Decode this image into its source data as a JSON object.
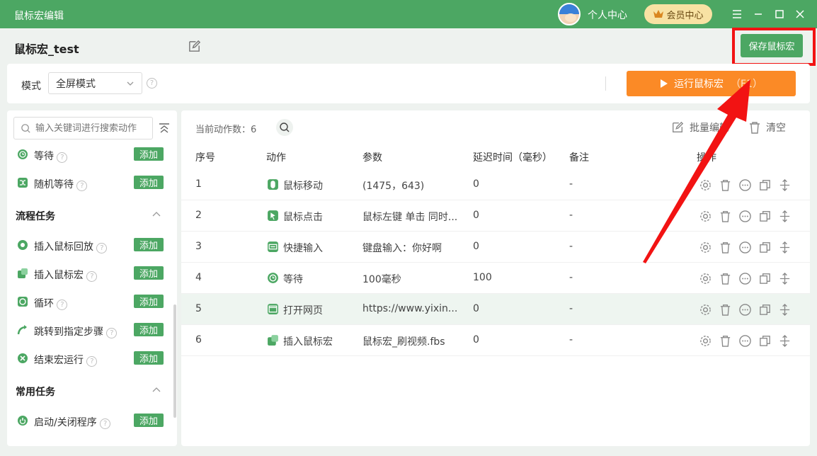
{
  "app": {
    "title": "鼠标宏编辑"
  },
  "titlebar": {
    "user_center": "个人中心",
    "vip_center": "会员中心"
  },
  "header": {
    "macro_name": "鼠标宏_test",
    "save_label": "保存鼠标宏"
  },
  "modebar": {
    "mode_label": "模式",
    "mode_value": "全屏模式",
    "run_label": "运行鼠标宏",
    "run_hotkey": "（F1）"
  },
  "sidebar": {
    "search_placeholder": "输入关键词进行搜索动作",
    "add_label": "添加",
    "items_top": [
      {
        "label": "等待",
        "icon": "clock-icon"
      },
      {
        "label": "随机等待",
        "icon": "shuffle-icon"
      }
    ],
    "section_flow": {
      "title": "流程任务",
      "items": [
        {
          "label": "插入鼠标回放",
          "icon": "replay-icon"
        },
        {
          "label": "插入鼠标宏",
          "icon": "puzzle-icon"
        },
        {
          "label": "循环",
          "icon": "loop-icon"
        },
        {
          "label": "跳转到指定步骤",
          "icon": "jump-icon"
        },
        {
          "label": "结束宏运行",
          "icon": "stop-icon"
        }
      ]
    },
    "section_common": {
      "title": "常用任务",
      "items": [
        {
          "label": "启动/关闭程序",
          "icon": "power-icon"
        }
      ]
    }
  },
  "content": {
    "count_label": "当前动作数：6",
    "bulk_edit": "批量编辑",
    "clear": "清空",
    "columns": [
      "序号",
      "动作",
      "参数",
      "延迟时间（毫秒）",
      "备注",
      "操作"
    ],
    "rows": [
      {
        "index": "1",
        "action": "鼠标移动",
        "param": "(1475，643)",
        "delay": "0",
        "note": "-",
        "icon": "mouse-icon"
      },
      {
        "index": "2",
        "action": "鼠标点击",
        "param": "鼠标左键 单击 同时...",
        "delay": "0",
        "note": "-",
        "icon": "click-icon"
      },
      {
        "index": "3",
        "action": "快捷输入",
        "param": "键盘输入：你好啊",
        "delay": "0",
        "note": "-",
        "icon": "keyboard-icon"
      },
      {
        "index": "4",
        "action": "等待",
        "param": "100毫秒",
        "delay": "100",
        "note": "-",
        "icon": "clock-icon"
      },
      {
        "index": "5",
        "action": "打开网页",
        "param": "https://www.yixin...",
        "delay": "0",
        "note": "-",
        "icon": "browser-icon"
      },
      {
        "index": "6",
        "action": "插入鼠标宏",
        "param": "鼠标宏_刷视频.fbs",
        "delay": "0",
        "note": "-",
        "icon": "puzzle-icon"
      }
    ]
  },
  "colors": {
    "brand_green": "#4ca763",
    "run_orange": "#fb8a26",
    "highlight_red": "#f21313",
    "vip_gold": "#f8e2a3"
  }
}
